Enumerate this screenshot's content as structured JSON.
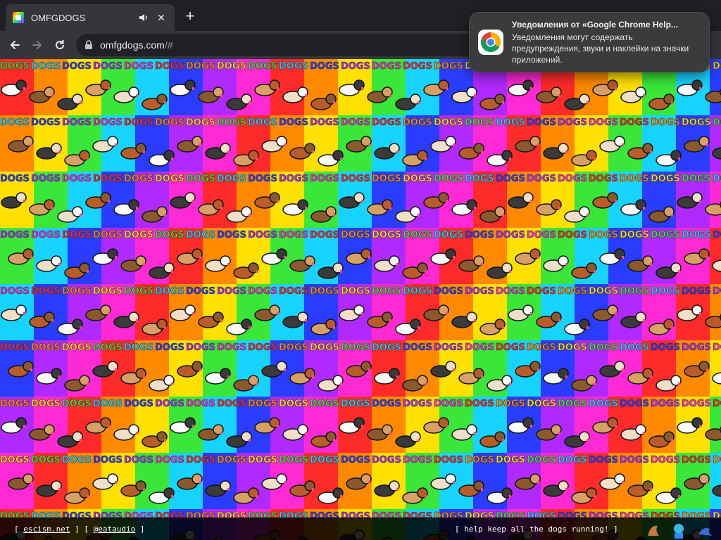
{
  "browser": {
    "tab": {
      "title": "OMFGDOGS",
      "close_glyph": "✕",
      "favicon": "omfgdogs-favicon",
      "audio_icon": "speaker-icon"
    },
    "new_tab_glyph": "+",
    "toolbar": {
      "back_icon": "arrow-left-icon",
      "forward_icon": "arrow-right-icon",
      "reload_icon": "reload-icon",
      "lock_icon": "lock-icon"
    },
    "address": {
      "host": "omfgdogs.com",
      "path": "/#"
    }
  },
  "page": {
    "background_description_colors": [
      "#ff2a2a",
      "#ff8a00",
      "#ffe100",
      "#39e639",
      "#16d4ff",
      "#2a3cff",
      "#b02aff",
      "#ff2ad4"
    ],
    "tile_text": "DOGS",
    "footer": {
      "open_bracket": "[ ",
      "close_bracket": " ]",
      "link1": "escism.net",
      "link2": "@eataudio",
      "separator": " ] [ ",
      "message": "[ help keep all the dogs running! ]"
    }
  },
  "notification": {
    "app_icon": "chrome-icon",
    "title": "Уведомления от «Google Chrome Help...",
    "body": "Уведомления могут содержать предупреждения, звуки и наклейки на значки приложений."
  }
}
